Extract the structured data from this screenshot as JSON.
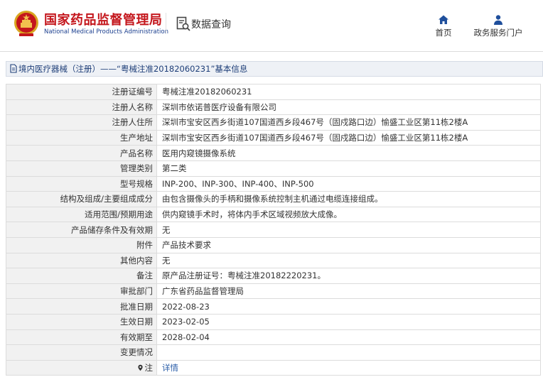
{
  "header": {
    "org_name_cn": "国家药品监督管理局",
    "org_name_en": "National Medical Products Administration",
    "section_label": "数据查询",
    "nav": {
      "home_label": "首页",
      "service_label": "政务服务门户"
    }
  },
  "breadcrumb": {
    "text": "境内医疗器械（注册）——“粤械注准20182060231”基本信息"
  },
  "details": {
    "rows": [
      {
        "label": "注册证编号",
        "value": "粤械注准20182060231"
      },
      {
        "label": "注册人名称",
        "value": "深圳市依诺普医疗设备有限公司"
      },
      {
        "label": "注册人住所",
        "value": "深圳市宝安区西乡街道107国道西乡段467号（固戍路口边）愉盛工业区第11栋2楼A"
      },
      {
        "label": "生产地址",
        "value": "深圳市宝安区西乡街道107国道西乡段467号（固戍路口边）愉盛工业区第11栋2楼A"
      },
      {
        "label": "产品名称",
        "value": "医用内窥镜摄像系统"
      },
      {
        "label": "管理类别",
        "value": "第二类"
      },
      {
        "label": "型号规格",
        "value": "INP-200、INP-300、INP-400、INP-500"
      },
      {
        "label": "结构及组成/主要组成成分",
        "value": "由包含摄像头的手柄和摄像系统控制主机通过电缆连接组成。"
      },
      {
        "label": "适用范围/预期用途",
        "value": "供内窥镜手术时，将体内手术区域视频放大成像。"
      },
      {
        "label": "产品储存条件及有效期",
        "value": "无"
      },
      {
        "label": "附件",
        "value": "产品技术要求"
      },
      {
        "label": "其他内容",
        "value": "无"
      },
      {
        "label": "备注",
        "value": "原产品注册证号：粤械注准20182220231。"
      },
      {
        "label": "审批部门",
        "value": "广东省药品监督管理局"
      },
      {
        "label": "批准日期",
        "value": "2022-08-23"
      },
      {
        "label": "生效日期",
        "value": "2023-02-05"
      },
      {
        "label": "有效期至",
        "value": "2028-02-04"
      },
      {
        "label": "变更情况",
        "value": ""
      }
    ],
    "note_row": {
      "label": "注",
      "link_text": "详情"
    }
  },
  "icons": [
    "national-emblem-icon",
    "search-document-icon",
    "home-icon",
    "user-icon",
    "document-icon",
    "note-icon"
  ],
  "colors": {
    "brand_red": "#c4161c",
    "brand_blue": "#1b3f8f",
    "nav_icon_blue": "#1f4f9c",
    "breadcrumb_bg": "#eef1f6",
    "label_cell_bg": "#f1f1f1",
    "link": "#2b5ea8"
  }
}
